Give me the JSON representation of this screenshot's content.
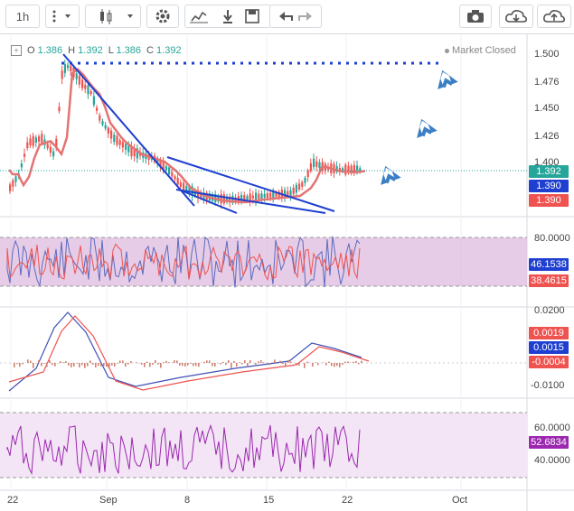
{
  "toolbar": {
    "interval": "1h",
    "icons": [
      "candles-icon",
      "indicators-icon",
      "download-icon",
      "save-icon",
      "undo-icon",
      "redo-icon",
      "camera-icon",
      "cloud-download-icon",
      "cloud-upload-icon"
    ]
  },
  "legend": {
    "o_label": "O",
    "o_value": "1.386",
    "h_label": "H",
    "h_value": "1.392",
    "l_label": "L",
    "l_value": "1.386",
    "c_label": "C",
    "c_value": "1.392",
    "status": "Market Closed"
  },
  "price_axis": [
    "1.500",
    "1.476",
    "1.450",
    "1.426",
    "1.400"
  ],
  "price_tags": {
    "last": "1.392",
    "a": "1.390",
    "b": "1.390"
  },
  "rsi_axis": [
    "80.0000"
  ],
  "rsi_tags": {
    "a": "46.1538",
    "b": "38.4615"
  },
  "macd_axis": [
    "0.0200",
    "-0.0100"
  ],
  "macd_tags": {
    "a": "0.0019",
    "b": "0.0015",
    "c": "-0.0004"
  },
  "stoch_axis": [
    "60.0000",
    "40.0000"
  ],
  "stoch_tags": {
    "a": "52.6834"
  },
  "x_axis": [
    "22",
    "Sep",
    "8",
    "15",
    "22",
    "Oct"
  ],
  "colors": {
    "up": "#26a69a",
    "down": "#ef5350",
    "ma": "#e57373",
    "rsi_fill": "#e0bfe0",
    "blue": "#1f3fd0",
    "purple": "#9c27b0",
    "arrow": "#3b7fc4"
  }
}
